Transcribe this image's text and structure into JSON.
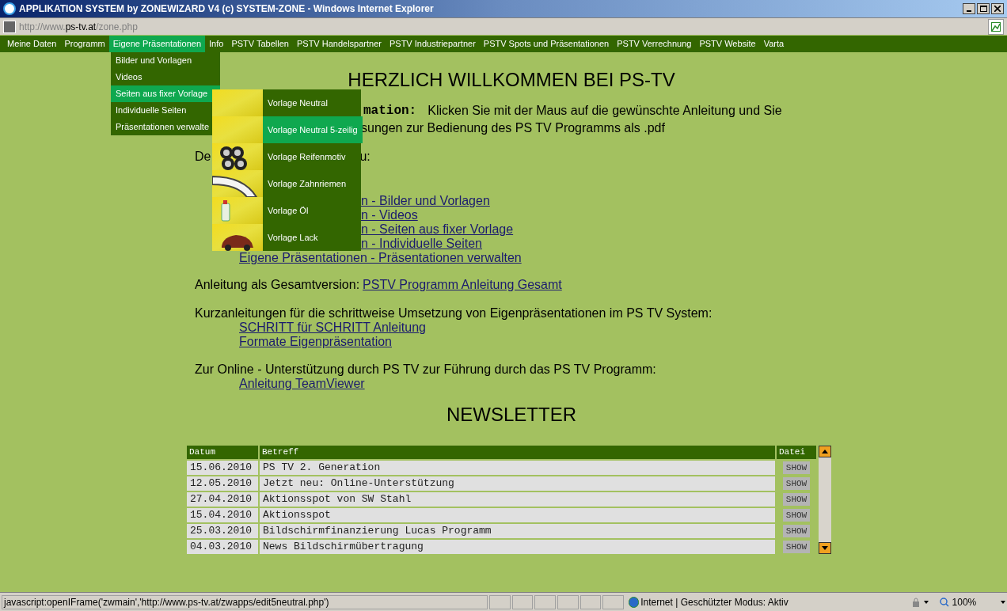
{
  "window": {
    "title": "APPLIKATION SYSTEM by ZONEWIZARD V4 (c) SYSTEM-ZONE - Windows Internet Explorer"
  },
  "address_bar": {
    "prefix": "http://www.",
    "domain": "ps-tv.at",
    "path": "/zone.php"
  },
  "menu": [
    {
      "label": "Meine Daten",
      "selected": false
    },
    {
      "label": "Programm",
      "selected": false
    },
    {
      "label": "Eigene Präsentationen",
      "selected": true
    },
    {
      "label": "Info",
      "selected": false
    },
    {
      "label": "PSTV Tabellen",
      "selected": false
    },
    {
      "label": "PSTV Handelspartner",
      "selected": false
    },
    {
      "label": "PSTV Industriepartner",
      "selected": false
    },
    {
      "label": "PSTV Spots und Präsentationen",
      "selected": false
    },
    {
      "label": "PSTV Verrechnung",
      "selected": false
    },
    {
      "label": "PSTV Website",
      "selected": false
    },
    {
      "label": "Varta",
      "selected": false
    }
  ],
  "submenu": [
    {
      "label": "Bilder und Vorlagen",
      "selected": false
    },
    {
      "label": "Videos",
      "selected": false
    },
    {
      "label": "Seiten aus fixer Vorlage",
      "selected": true
    },
    {
      "label": "Individuelle Seiten",
      "selected": false
    },
    {
      "label": "Präsentationen verwalte",
      "selected": false
    }
  ],
  "template_menu": [
    {
      "label": "Vorlage Neutral",
      "selected": false
    },
    {
      "label": "Vorlage Neutral 5-zeilig",
      "selected": true
    },
    {
      "label": "Vorlage Reifenmotiv",
      "selected": false
    },
    {
      "label": "Vorlage Zahnriemen",
      "selected": false
    },
    {
      "label": "Vorlage Öl",
      "selected": false
    },
    {
      "label": "Vorlage Lack",
      "selected": false
    }
  ],
  "content": {
    "heading": "HERZLICH WILLKOMMEN BEI PS-TV",
    "info_label": "mation:",
    "info_text_1": "Klicken Sie mit der Maus auf die gewünschte Anleitung und Sie",
    "info_text_2": "sungen zur Bedienung des PS TV Programms als .pdf",
    "intro_start": "De",
    "intro_end": "u:",
    "partial_links": [
      "n - Bilder und Vorlagen",
      "n - Videos",
      "n - Seiten aus fixer Vorlage",
      "n - Individuelle Seiten"
    ],
    "full_link": "Eigene Präsentationen - Präsentationen verwalten",
    "complete_label": "Anleitung als Gesamtversion:",
    "complete_link": "PSTV Programm Anleitung Gesamt",
    "short_label": "Kurzanleitungen für die schrittweise Umsetzung von Eigenpräsentationen im PS TV System:",
    "short_links": [
      "SCHRITT für SCHRITT Anleitung",
      "Formate Eigenpräsentation"
    ],
    "support_label": "Zur Online - Unterstützung durch PS TV zur Führung durch das PS TV Programm:",
    "support_links": [
      "Anleitung TeamViewer"
    ]
  },
  "newsletter": {
    "heading": "NEWSLETTER",
    "columns": [
      "Datum",
      "Betreff",
      "Datei"
    ],
    "rows": [
      {
        "date": "15.06.2010",
        "subject": "PS TV 2. Generation",
        "button": "SHOW"
      },
      {
        "date": "12.05.2010",
        "subject": "Jetzt neu: Online-Unterstützung",
        "button": "SHOW"
      },
      {
        "date": "27.04.2010",
        "subject": "Aktionsspot von SW Stahl",
        "button": "SHOW"
      },
      {
        "date": "15.04.2010",
        "subject": "Aktionsspot",
        "button": "SHOW"
      },
      {
        "date": "25.03.2010",
        "subject": "Bildschirmfinanzierung Lucas Programm",
        "button": "SHOW"
      },
      {
        "date": "04.03.2010",
        "subject": "News Bildschirmübertragung",
        "button": "SHOW"
      }
    ]
  },
  "status_bar": {
    "text": "javascript:openIFrame('zwmain','http://www.ps-tv.at/zwapps/edit5neutral.php')",
    "zone": "Internet | Geschützter Modus: Aktiv",
    "zoom": "100%"
  }
}
